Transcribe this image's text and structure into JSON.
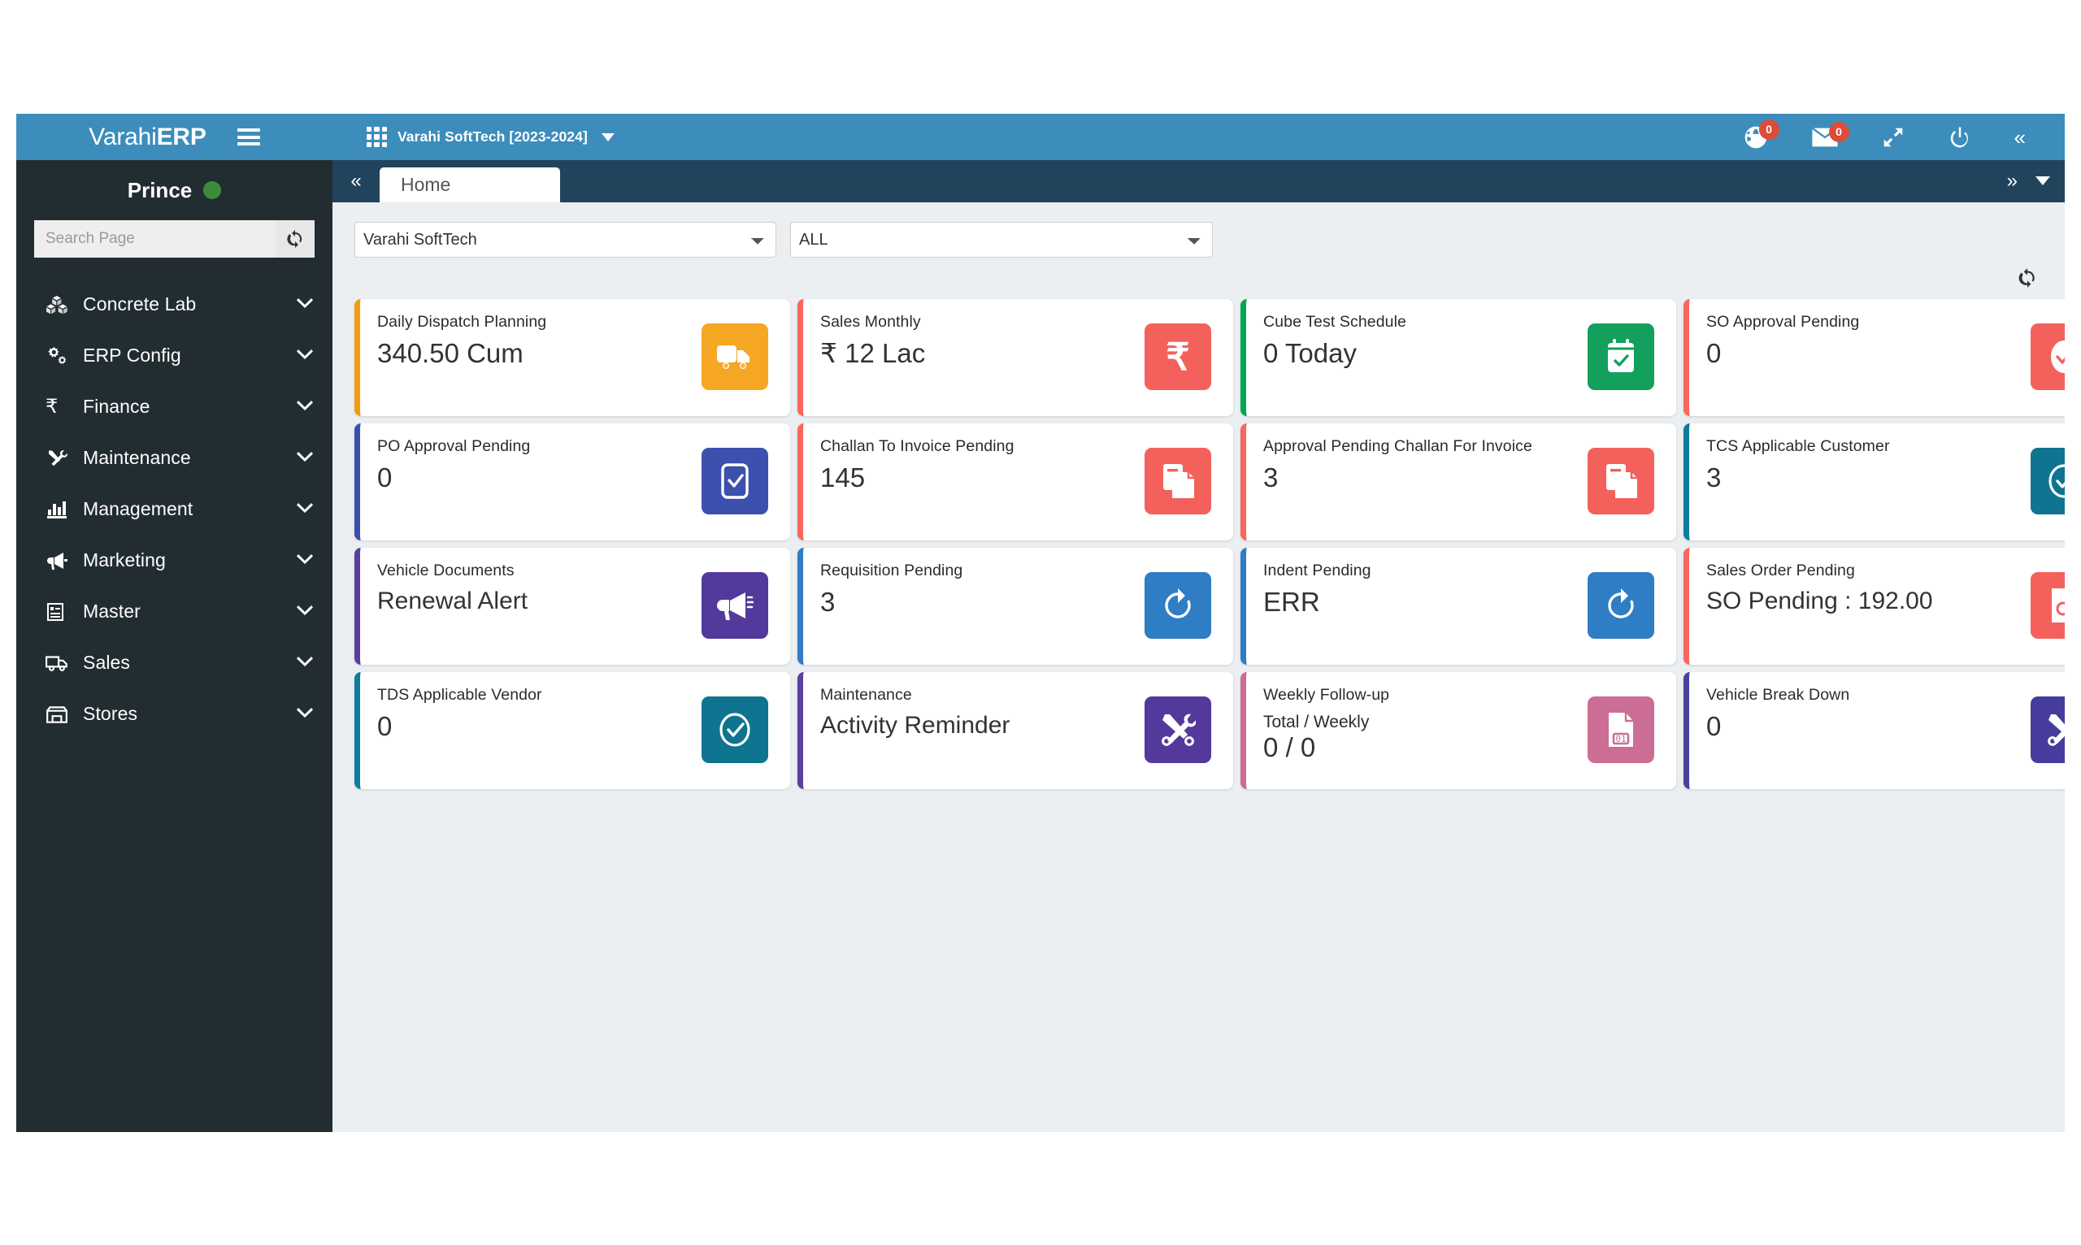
{
  "topbar": {
    "brand_text_light": "Varahi",
    "brand_text_bold": "ERP",
    "company": "Varahi SoftTech [2023-2024]",
    "notifications_count": "0",
    "messages_count": "0",
    "accent_color": "#3c8dbc",
    "badge_color": "#dd4b39"
  },
  "sidebar": {
    "user_name": "Prince",
    "status_color": "#3c8c3c",
    "search_placeholder": "Search Page",
    "search_value": "",
    "items": [
      {
        "label": "Concrete Lab",
        "icon": "cubes-icon"
      },
      {
        "label": "ERP Config",
        "icon": "cogs-icon"
      },
      {
        "label": "Finance",
        "icon": "rupee-icon"
      },
      {
        "label": "Maintenance",
        "icon": "wrench-screwdriver-icon"
      },
      {
        "label": "Management",
        "icon": "bar-chart-icon"
      },
      {
        "label": "Marketing",
        "icon": "bullhorn-icon"
      },
      {
        "label": "Master",
        "icon": "list-alt-icon"
      },
      {
        "label": "Sales",
        "icon": "truck-icon"
      },
      {
        "label": "Stores",
        "icon": "store-icon"
      }
    ]
  },
  "tabs": {
    "active": "Home",
    "items": [
      "Home"
    ]
  },
  "filters": {
    "company_selected": "Varahi SoftTech",
    "company_options": [
      "Varahi SoftTech"
    ],
    "scope_selected": "ALL",
    "scope_options": [
      "ALL"
    ]
  },
  "cards": [
    {
      "title": "Daily Dispatch Planning",
      "value": "340.50 Cum",
      "sub": "",
      "accent": "#f39c12",
      "icon_bg": "#f5a623",
      "icon": "truck-icon"
    },
    {
      "title": "Sales Monthly",
      "value": "₹ 12 Lac",
      "sub": "",
      "accent": "#f8665c",
      "icon_bg": "#f4615c",
      "icon": "rupee-icon"
    },
    {
      "title": "Cube Test Schedule",
      "value": "0 Today",
      "sub": "",
      "accent": "#00a651",
      "icon_bg": "#12a05c",
      "icon": "calendar-check-icon"
    },
    {
      "title": "SO Approval Pending",
      "value": "0",
      "sub": "",
      "accent": "#f8665c",
      "icon_bg": "#f4615c",
      "icon": "check-circle-icon"
    },
    {
      "title": "PO Approval Pending",
      "value": "0",
      "sub": "",
      "accent": "#3b50ac",
      "icon_bg": "#3c50ad",
      "icon": "clipboard-check-icon"
    },
    {
      "title": "Challan To Invoice Pending",
      "value": "145",
      "sub": "",
      "accent": "#f8665c",
      "icon_bg": "#f4615c",
      "icon": "file-copy-icon"
    },
    {
      "title": "Approval Pending Challan For Invoice",
      "value": "3",
      "sub": "",
      "accent": "#f8665c",
      "icon_bg": "#f4615c",
      "icon": "file-copy-icon"
    },
    {
      "title": "TCS Applicable Customer",
      "value": "3",
      "sub": "",
      "accent": "#0f7b9c",
      "icon_bg": "#0e7490",
      "icon": "check-circle-outline-icon"
    },
    {
      "title": "Vehicle Documents",
      "value": "Renewal Alert",
      "sub": "",
      "accent": "#5b3f9e",
      "icon_bg": "#53399b",
      "icon": "bullhorn-icon"
    },
    {
      "title": "Requisition Pending",
      "value": "3",
      "sub": "",
      "accent": "#2f7dc4",
      "icon_bg": "#2f7dc4",
      "icon": "refresh-icon"
    },
    {
      "title": "Indent Pending",
      "value": "ERR",
      "sub": "",
      "accent": "#2f7dc4",
      "icon_bg": "#2f7dc4",
      "icon": "refresh-icon"
    },
    {
      "title": "Sales Order Pending",
      "value": "SO Pending : 192.00",
      "sub": "",
      "accent": "#f8665c",
      "icon_bg": "#f4615c",
      "icon": "file-search-icon"
    },
    {
      "title": "TDS Applicable Vendor",
      "value": "0",
      "sub": "",
      "accent": "#0f7b9c",
      "icon_bg": "#0e7490",
      "icon": "check-circle-outline-icon"
    },
    {
      "title": "Maintenance",
      "value": "Activity Reminder",
      "sub": "",
      "accent": "#5b3f9e",
      "icon_bg": "#53399b",
      "icon": "wrench-screwdriver-icon"
    },
    {
      "title": "Weekly Follow-up",
      "value": "0 / 0",
      "sub": "Total / Weekly",
      "accent": "#ce6b94",
      "icon_bg": "#cb6d94",
      "icon": "file-number-icon"
    },
    {
      "title": "Vehicle Break Down",
      "value": "0",
      "sub": "",
      "accent": "#4b3fa0",
      "icon_bg": "#463c9e",
      "icon": "wrench-screwdriver-icon"
    }
  ]
}
